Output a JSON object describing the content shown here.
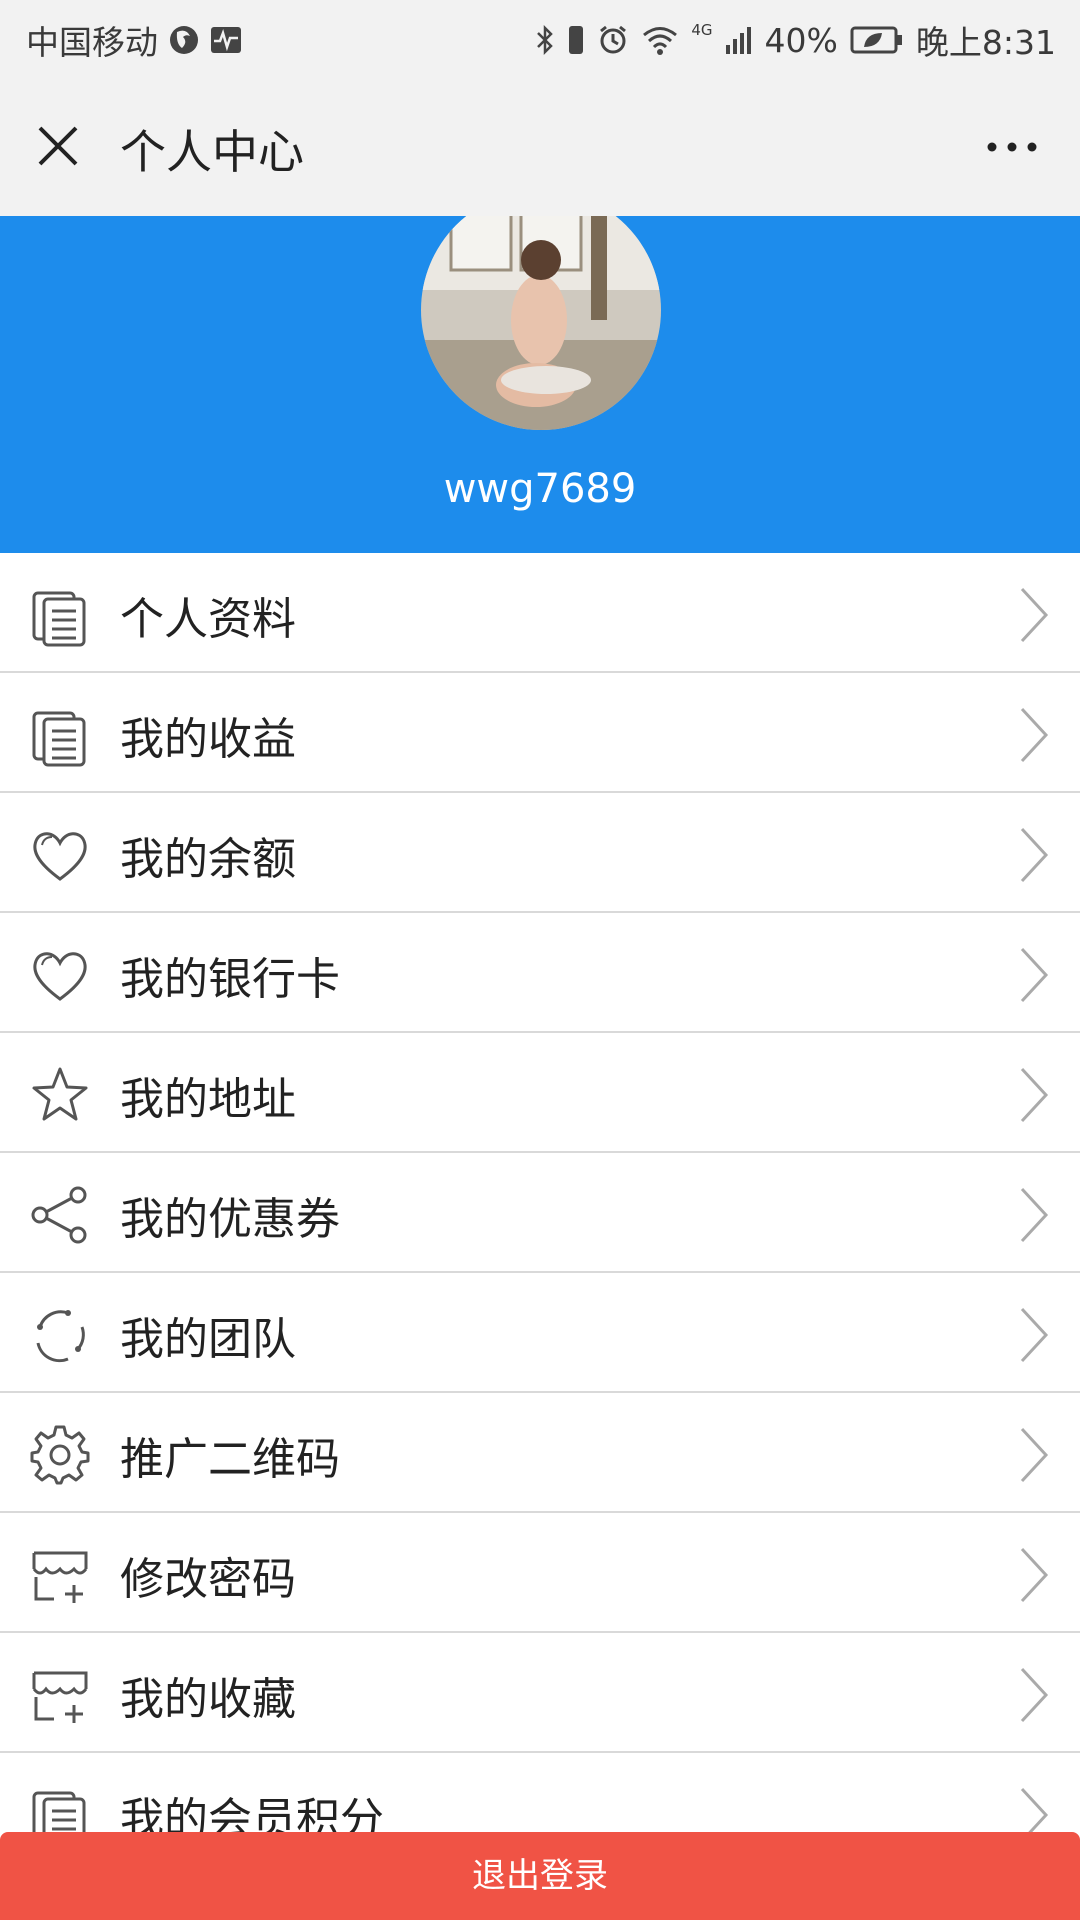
{
  "status_bar": {
    "carrier": "中国移动",
    "network": "4G",
    "battery": "40%",
    "time": "晚上8:31",
    "icons": [
      "firefox-icon",
      "activity-icon",
      "bluetooth-icon",
      "vibrate-icon",
      "alarm-icon",
      "wifi-icon",
      "signal-icon",
      "battery-icon"
    ]
  },
  "title_bar": {
    "title": "个人中心",
    "close_icon": "close-icon",
    "more_icon": "more-icon"
  },
  "profile": {
    "username": "wwg7689",
    "avatar": "avatar"
  },
  "menu": [
    {
      "label": "个人资料",
      "icon": "document-icon"
    },
    {
      "label": "我的收益",
      "icon": "document-icon"
    },
    {
      "label": "我的余额",
      "icon": "heart-icon"
    },
    {
      "label": "我的银行卡",
      "icon": "heart-icon"
    },
    {
      "label": "我的地址",
      "icon": "star-icon"
    },
    {
      "label": "我的优惠券",
      "icon": "share-icon"
    },
    {
      "label": "我的团队",
      "icon": "refresh-icon"
    },
    {
      "label": "推广二维码",
      "icon": "gear-icon"
    },
    {
      "label": "修改密码",
      "icon": "shop-add-icon"
    },
    {
      "label": "我的收藏",
      "icon": "shop-add-icon"
    },
    {
      "label": "我的会员积分",
      "icon": "document-icon"
    }
  ],
  "logout": {
    "label": "退出登录"
  },
  "colors": {
    "header_blue": "#1d8cec",
    "logout_red": "#f05345",
    "bar_gray": "#f2f2f2"
  }
}
